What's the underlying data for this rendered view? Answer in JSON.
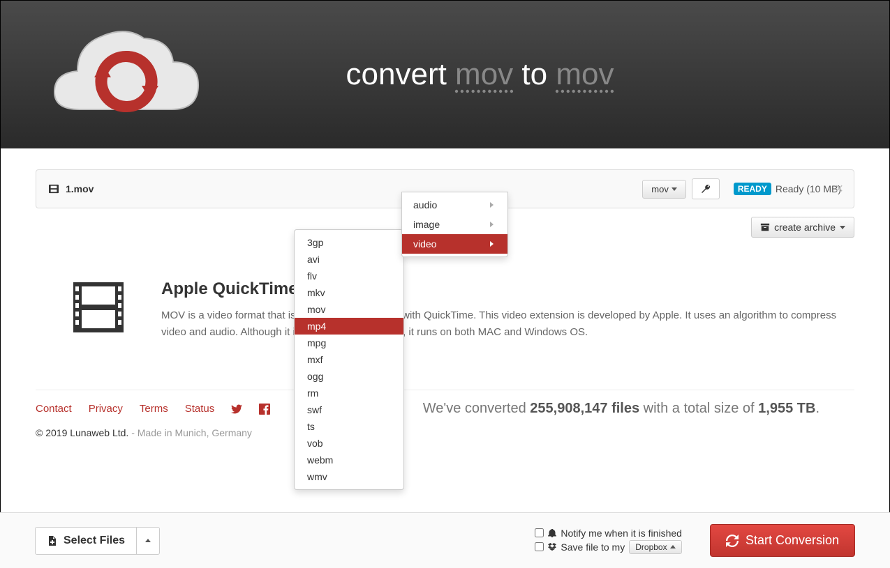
{
  "header": {
    "title_pre": "convert ",
    "from": "mov",
    "title_mid": " to ",
    "to": "mov"
  },
  "file": {
    "name": "1.mov",
    "format_btn": "mov",
    "ready_badge": "READY",
    "ready_text": " Ready (10 MB)"
  },
  "archive_btn": "create archive",
  "categories": [
    {
      "label": "audio"
    },
    {
      "label": "image"
    },
    {
      "label": "video"
    }
  ],
  "video_formats": [
    "3gp",
    "avi",
    "flv",
    "mkv",
    "mov",
    "mp4",
    "mpg",
    "mxf",
    "ogg",
    "rm",
    "swf",
    "ts",
    "vob",
    "webm",
    "wmv"
  ],
  "hover_format": "mp4",
  "desc": {
    "heading": "Apple QuickTime Movie",
    "body": "MOV is a video format that is commonly associated with QuickTime. This video extension is developed by Apple. It uses an algorithm to compress video and audio. Although it is a proprietary of Apple, it runs on both MAC and Windows OS."
  },
  "footer": {
    "links": [
      "Contact",
      "Privacy",
      "Terms",
      "Status"
    ],
    "copyright": "© 2019 Lunaweb Ltd. ",
    "made_in": "- Made in Munich, Germany",
    "stats_pre": "We've converted ",
    "stats_files": "255,908,147 files",
    "stats_mid": " with a total size of ",
    "stats_size": "1,955 TB",
    "stats_post": "."
  },
  "bottom": {
    "select_files": "Select Files",
    "notify": "Notify me when it is finished",
    "save_to": "Save file to my",
    "dropbox": "Dropbox",
    "start": "Start Conversion"
  }
}
